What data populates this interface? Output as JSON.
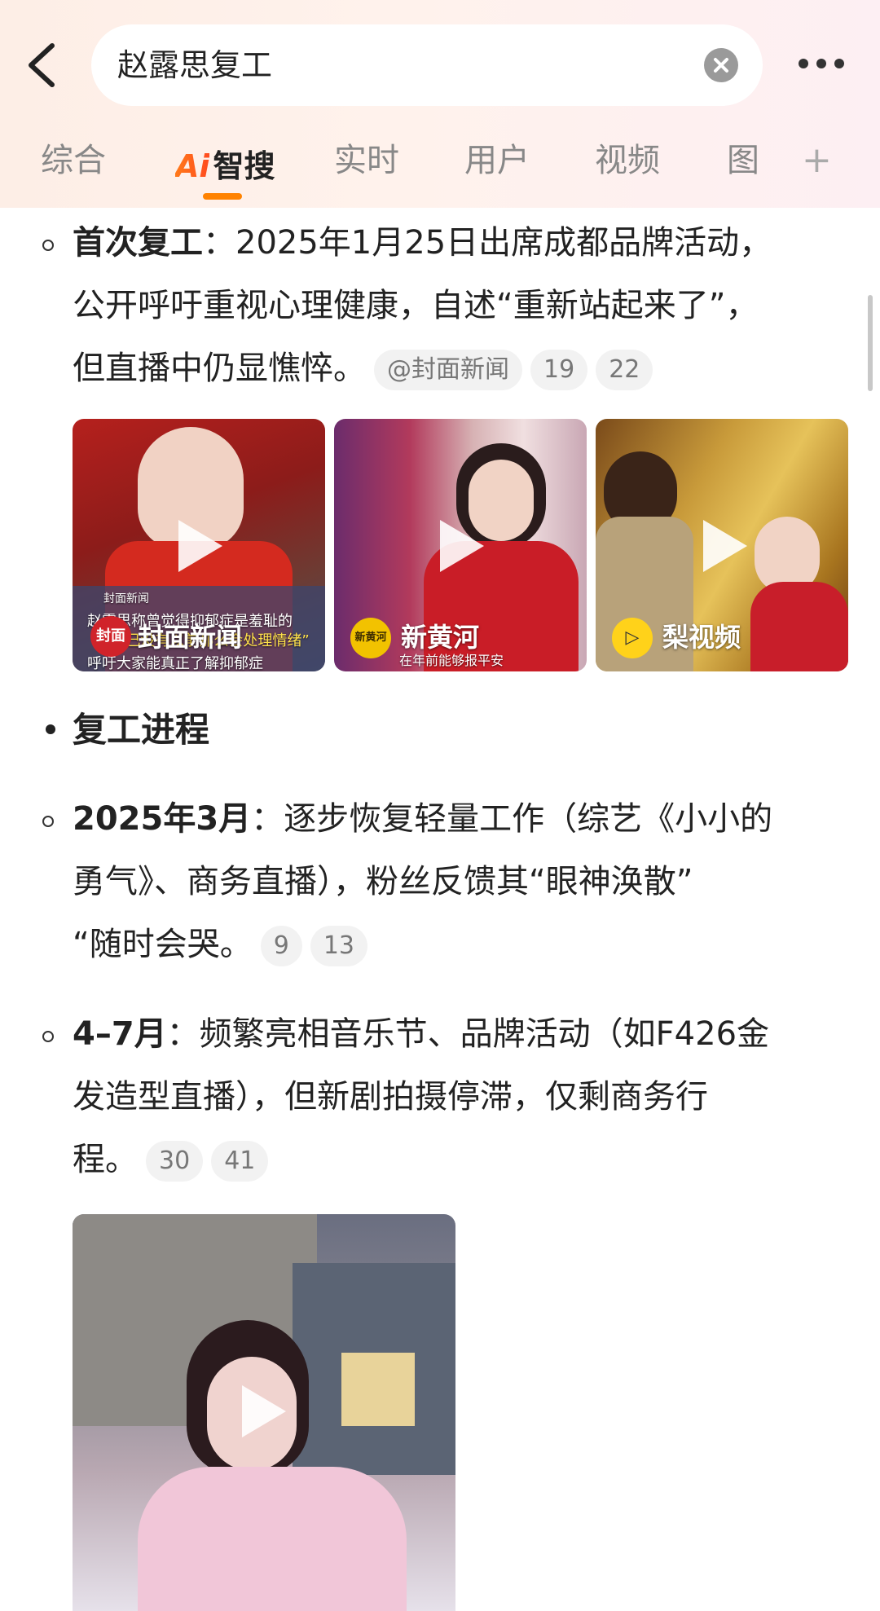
{
  "search": {
    "query": "赵露思复工"
  },
  "tabs": {
    "zonghe": "综合",
    "ai_logo": "Ai",
    "ai_text": "智搜",
    "shishi": "实时",
    "yonghu": "用户",
    "shipin": "视频",
    "tu": "图",
    "plus": "+"
  },
  "content": {
    "first": {
      "label": "首次复工",
      "colon": "：",
      "line1": "2025年1月25日出席成都品牌活动，",
      "line2": "公开呼吁重视心理健康，自述“重新站起来了”，",
      "line3": "但直播中仍显憔悴。",
      "source": "@封面新闻",
      "ref1": "19",
      "ref2": "22"
    },
    "videos_row": [
      {
        "logo_text": "封面",
        "source_name": "封面新闻",
        "caption_top": "封面新闻",
        "caption_line1": "赵露思称曾觉得抑郁症是羞耻的",
        "caption_line2": "“自己没有以前那么会处理情绪”",
        "caption_line3": "呼吁大家能真正了解抑郁症"
      },
      {
        "logo_text": "新黄河",
        "source_name": "新黄河",
        "caption": "在年前能够报平安"
      },
      {
        "logo_text": "▷",
        "source_name": "梨视频"
      }
    ],
    "progress_title": "复工进程",
    "march": {
      "label": "2025年3月",
      "colon": "：",
      "line1": "逐步恢复轻量工作（综艺《小小的",
      "line2": "勇气》、商务直播），粉丝反馈其“眼神涣散”",
      "line3": "“随时会哭。",
      "ref1": "9",
      "ref2": "13"
    },
    "april": {
      "label": "4–7月",
      "colon": "：",
      "line1": "频繁亮相音乐节、品牌活动（如F426金",
      "line2": "发造型直播），但新剧拍摄停滞，仅剩商务行",
      "line3": "程。",
      "ref1": "30",
      "ref2": "41"
    }
  },
  "colors": {
    "accent": "#ff8200",
    "chip_bg": "#f2f2f2",
    "text": "#222222"
  }
}
